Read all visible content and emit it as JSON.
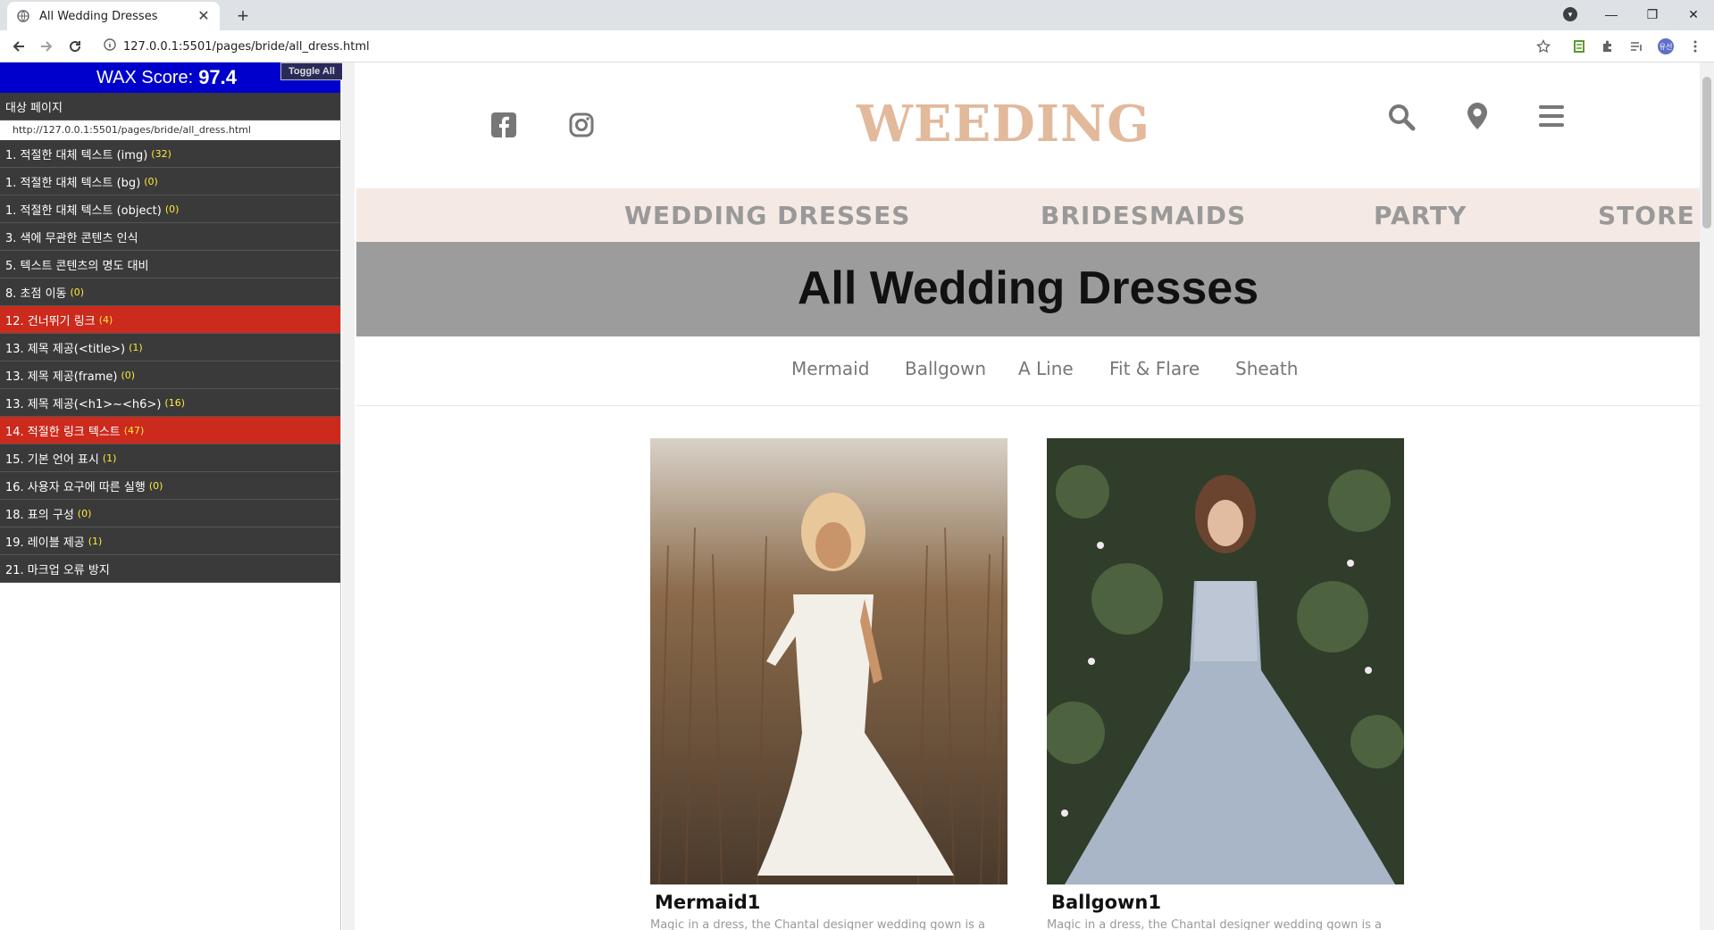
{
  "browser": {
    "tab_title": "All Wedding Dresses",
    "tab_close": "✕",
    "new_tab": "+",
    "url": "127.0.0.1:5501/pages/bride/all_dress.html",
    "window_minimize": "—",
    "window_restore": "❐",
    "window_close": "✕",
    "avatar_label": "유선"
  },
  "wax": {
    "score_label": "WAX Score:",
    "score_value": "97.4",
    "toggle_all": "Toggle All",
    "target_page_label": "대상 페이지",
    "target_url": "http://127.0.0.1:5501/pages/bride/all_dress.html",
    "items": [
      {
        "label": "1. 적절한 대체 텍스트 (img)",
        "count": "(32)",
        "status": "normal"
      },
      {
        "label": "1. 적절한 대체 텍스트 (bg)",
        "count": "(0)",
        "status": "normal"
      },
      {
        "label": "1. 적절한 대체 텍스트 (object)",
        "count": "(0)",
        "status": "normal"
      },
      {
        "label": "3. 색에 무관한 콘텐츠 인식",
        "count": "",
        "status": "normal"
      },
      {
        "label": "5. 텍스트 콘텐츠의 명도 대비",
        "count": "",
        "status": "normal"
      },
      {
        "label": "8. 초점 이동",
        "count": "(0)",
        "status": "normal"
      },
      {
        "label": "12. 건너뛰기 링크",
        "count": "(4)",
        "status": "error"
      },
      {
        "label": "13. 제목 제공(<title>)",
        "count": "(1)",
        "status": "normal"
      },
      {
        "label": "13. 제목 제공(frame)",
        "count": "(0)",
        "status": "normal"
      },
      {
        "label": "13. 제목 제공(<h1>~<h6>)",
        "count": "(16)",
        "status": "normal"
      },
      {
        "label": "14. 적절한 링크 텍스트",
        "count": "(47)",
        "status": "error"
      },
      {
        "label": "15. 기본 언어 표시",
        "count": "(1)",
        "status": "normal"
      },
      {
        "label": "16. 사용자 요구에 따른 실행",
        "count": "(0)",
        "status": "normal"
      },
      {
        "label": "18. 표의 구성",
        "count": "(0)",
        "status": "normal"
      },
      {
        "label": "19. 레이블 제공",
        "count": "(1)",
        "status": "normal"
      },
      {
        "label": "21. 마크업 오류 방지",
        "count": "",
        "status": "normal"
      }
    ]
  },
  "site": {
    "logo": "WEEDING",
    "nav": [
      "WEDDING DRESSES",
      "BRIDESMAIDS",
      "PARTY",
      "STORE"
    ],
    "page_title": "All Wedding Dresses",
    "categories": [
      "Mermaid",
      "Ballgown",
      "A Line",
      "Fit & Flare",
      "Sheath"
    ],
    "products": [
      {
        "name": "Mermaid1",
        "desc": "Magic in a dress, the Chantal designer wedding gown is a"
      },
      {
        "name": "Ballgown1",
        "desc": "Magic in a dress, the Chantal designer wedding gown is a"
      }
    ]
  },
  "colors": {
    "logo": "#e2b99b",
    "nav_bg": "#f5e9e4",
    "banner_bg": "#9c9c9c",
    "wax_header": "#0000cc",
    "wax_error": "#cc2a1c"
  }
}
